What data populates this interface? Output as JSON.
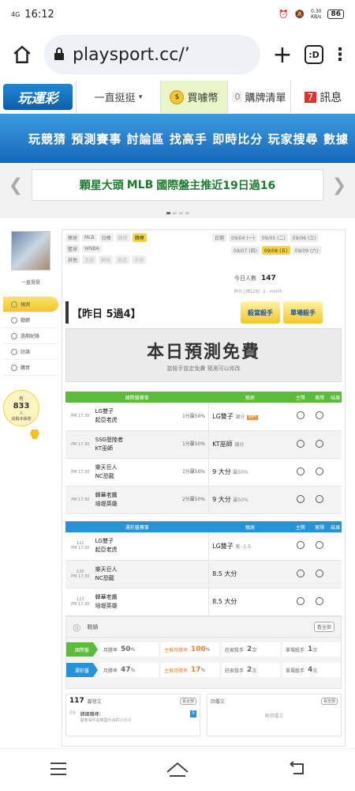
{
  "status": {
    "time": "16:12",
    "signal": "4G",
    "speed": "0.30\nKB/s",
    "battery": "86"
  },
  "browser": {
    "url": "playsport.cc/’",
    "tabs_count": ":D"
  },
  "site": {
    "logo": "玩運彩",
    "dropdown": "一直挺挺",
    "coin": "買噱幣",
    "coin_icon": "$",
    "buylist_count": "0",
    "buylist": "購牌清單",
    "msg_count": "7",
    "msg": "訊息"
  },
  "mainnav": [
    "玩競猜",
    "預測賽事",
    "討論區",
    "找高手",
    "即時比分",
    "玩家搜尋",
    "數據"
  ],
  "banner": {
    "pre": "顆星大頭",
    "mlb": "MLB",
    "post": "國際盤主推近19日過16"
  },
  "sidebar": {
    "name": "一直挺挺",
    "menu": [
      "預測",
      "戰績",
      "過期紀錄",
      "討論",
      "購買"
    ],
    "online_prefix": "有",
    "online_count": "833",
    "online_suffix": "人\n追蹤本帳號"
  },
  "filters": {
    "sport_label": "棒球",
    "sports": [
      "MLB",
      "日棒",
      "韓棒",
      "韓棒"
    ],
    "basket_label": "籃球",
    "basket": [
      "WNBA"
    ],
    "other_label": "其他",
    "others": [
      "足球",
      "網球",
      "美足",
      "冰球"
    ],
    "date_label": "日期",
    "dates": [
      "09/04 (一)",
      "09/05 (二)",
      "09/06 (三)",
      "09/07 (四)",
      "09/08 (五)",
      "09/09 (六)"
    ],
    "today_label": "今日人數",
    "today_count": "147",
    "rank": "昨日上榜12名！1 - month"
  },
  "yesterday": "【昨日 5過4】",
  "badges": [
    "殺當殺手",
    "單場殺手"
  ],
  "free": {
    "title": "本日預測免費",
    "sub": "當殺手設定免費 預測可以修改"
  },
  "intl": {
    "header": [
      "國際盤賽事",
      "預測",
      "主隊",
      "客隊",
      "結果"
    ],
    "rows": [
      {
        "time": "PM 17:30",
        "t1": "LG雙子",
        "t2": "起亞老虎",
        "o1": "1分贏50%",
        "pred": "LG雙子",
        "pred_sub": "讓分",
        "tag": "熱門"
      },
      {
        "time": "PM 17:30",
        "t1": "SSG登陸者",
        "t2": "KT巫師",
        "o1": "1分贏50%",
        "pred": "KT巫師",
        "pred_sub": "讓分",
        "tag": ""
      },
      {
        "time": "PM 17:30",
        "t1": "樂天巨人",
        "t2": "NC恐龍",
        "o1": "1分贏50%",
        "pred": "9 大分",
        "pred_sub": "贏50%",
        "tag": ""
      },
      {
        "time": "PM 17:30",
        "t1": "韓華老鷹",
        "t2": "培堤英雄",
        "o1": "2分贏50%",
        "pred": "9 大分",
        "pred_sub": "贏50%",
        "tag": ""
      }
    ]
  },
  "tw": {
    "header": [
      "運彩盤賽事",
      "預測",
      "主隊",
      "客隊",
      "結果"
    ],
    "rows": [
      {
        "time": "122\nPM 17:30",
        "t1": "LG雙子",
        "t2": "起亞老虎",
        "pred": "LG雙子",
        "pred_sub": "客 -1.5"
      },
      {
        "time": "120\nPM 17:30",
        "t1": "樂天巨人",
        "t2": "NC恐龍",
        "pred": "8.5 大分",
        "pred_sub": ""
      },
      {
        "time": "123\nPM 17:30",
        "t1": "韓華老鷹",
        "t2": "培堤英雄",
        "pred": "8.5 大分",
        "pred_sub": ""
      }
    ]
  },
  "stats": {
    "title": "戰績",
    "more": "看全部",
    "rows": [
      {
        "label": "國際盤",
        "color": "#5cbb3b",
        "a": "月勝率",
        "av": "50",
        "b": "主推月勝率",
        "bv": "100",
        "c": "莊家殺手",
        "cv": "2",
        "d": "單場殺手",
        "dv": "1"
      },
      {
        "label": "運彩盤",
        "color": "#2693d8",
        "a": "月勝率",
        "av": "47",
        "b": "主推月勝率",
        "bv": "17",
        "c": "莊家殺手",
        "cv": "2",
        "d": "單場殺手",
        "dv": "4"
      }
    ]
  },
  "posts": {
    "count": "117",
    "label": "篇發文",
    "more": "看全部",
    "item_num": "09",
    "item_title": "韓國職棒：",
    "item_sub": "開會事件前韓國大谷的小日子",
    "item_tag": "5"
  },
  "replies": {
    "label": "回覆文",
    "more": "看全部",
    "empty": "無回覆文"
  }
}
